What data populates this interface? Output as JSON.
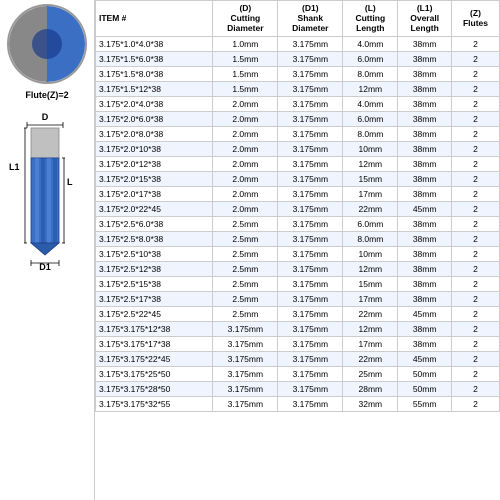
{
  "flute_label": "Flute(Z)=2",
  "labels": {
    "D": "D",
    "L": "L",
    "L1": "L1",
    "D1": "D1"
  },
  "table": {
    "headers": [
      {
        "id": "item",
        "line1": "ITEM #",
        "line2": ""
      },
      {
        "id": "D",
        "line1": "(D)",
        "line2": "Cutting Diameter"
      },
      {
        "id": "D1",
        "line1": "(D1)",
        "line2": "Shank Diameter"
      },
      {
        "id": "L",
        "line1": "(L)",
        "line2": "Cutting Length"
      },
      {
        "id": "L1",
        "line1": "(L1)",
        "line2": "Overall Length"
      },
      {
        "id": "Z",
        "line1": "(Z)",
        "line2": "Flutes"
      }
    ],
    "rows": [
      {
        "item": "3.175*1.0*4.0*38",
        "D": "1.0mm",
        "D1": "3.175mm",
        "L": "4.0mm",
        "L1": "38mm",
        "Z": "2"
      },
      {
        "item": "3.175*1.5*6.0*38",
        "D": "1.5mm",
        "D1": "3.175mm",
        "L": "6.0mm",
        "L1": "38mm",
        "Z": "2"
      },
      {
        "item": "3.175*1.5*8.0*38",
        "D": "1.5mm",
        "D1": "3.175mm",
        "L": "8.0mm",
        "L1": "38mm",
        "Z": "2"
      },
      {
        "item": "3.175*1.5*12*38",
        "D": "1.5mm",
        "D1": "3.175mm",
        "L": "12mm",
        "L1": "38mm",
        "Z": "2"
      },
      {
        "item": "3.175*2.0*4.0*38",
        "D": "2.0mm",
        "D1": "3.175mm",
        "L": "4.0mm",
        "L1": "38mm",
        "Z": "2"
      },
      {
        "item": "3.175*2.0*6.0*38",
        "D": "2.0mm",
        "D1": "3.175mm",
        "L": "6.0mm",
        "L1": "38mm",
        "Z": "2"
      },
      {
        "item": "3.175*2.0*8.0*38",
        "D": "2.0mm",
        "D1": "3.175mm",
        "L": "8.0mm",
        "L1": "38mm",
        "Z": "2"
      },
      {
        "item": "3.175*2.0*10*38",
        "D": "2.0mm",
        "D1": "3.175mm",
        "L": "10mm",
        "L1": "38mm",
        "Z": "2"
      },
      {
        "item": "3.175*2.0*12*38",
        "D": "2.0mm",
        "D1": "3.175mm",
        "L": "12mm",
        "L1": "38mm",
        "Z": "2"
      },
      {
        "item": "3.175*2.0*15*38",
        "D": "2.0mm",
        "D1": "3.175mm",
        "L": "15mm",
        "L1": "38mm",
        "Z": "2"
      },
      {
        "item": "3.175*2.0*17*38",
        "D": "2.0mm",
        "D1": "3.175mm",
        "L": "17mm",
        "L1": "38mm",
        "Z": "2"
      },
      {
        "item": "3.175*2.0*22*45",
        "D": "2.0mm",
        "D1": "3.175mm",
        "L": "22mm",
        "L1": "45mm",
        "Z": "2"
      },
      {
        "item": "3.175*2.5*6.0*38",
        "D": "2.5mm",
        "D1": "3.175mm",
        "L": "6.0mm",
        "L1": "38mm",
        "Z": "2"
      },
      {
        "item": "3.175*2.5*8.0*38",
        "D": "2.5mm",
        "D1": "3.175mm",
        "L": "8.0mm",
        "L1": "38mm",
        "Z": "2"
      },
      {
        "item": "3.175*2.5*10*38",
        "D": "2.5mm",
        "D1": "3.175mm",
        "L": "10mm",
        "L1": "38mm",
        "Z": "2"
      },
      {
        "item": "3.175*2.5*12*38",
        "D": "2.5mm",
        "D1": "3.175mm",
        "L": "12mm",
        "L1": "38mm",
        "Z": "2"
      },
      {
        "item": "3.175*2.5*15*38",
        "D": "2.5mm",
        "D1": "3.175mm",
        "L": "15mm",
        "L1": "38mm",
        "Z": "2"
      },
      {
        "item": "3.175*2.5*17*38",
        "D": "2.5mm",
        "D1": "3.175mm",
        "L": "17mm",
        "L1": "38mm",
        "Z": "2"
      },
      {
        "item": "3.175*2.5*22*45",
        "D": "2.5mm",
        "D1": "3.175mm",
        "L": "22mm",
        "L1": "45mm",
        "Z": "2"
      },
      {
        "item": "3.175*3.175*12*38",
        "D": "3.175mm",
        "D1": "3.175mm",
        "L": "12mm",
        "L1": "38mm",
        "Z": "2"
      },
      {
        "item": "3.175*3.175*17*38",
        "D": "3.175mm",
        "D1": "3.175mm",
        "L": "17mm",
        "L1": "38mm",
        "Z": "2"
      },
      {
        "item": "3.175*3.175*22*45",
        "D": "3.175mm",
        "D1": "3.175mm",
        "L": "22mm",
        "L1": "45mm",
        "Z": "2"
      },
      {
        "item": "3.175*3.175*25*50",
        "D": "3.175mm",
        "D1": "3.175mm",
        "L": "25mm",
        "L1": "50mm",
        "Z": "2"
      },
      {
        "item": "3.175*3.175*28*50",
        "D": "3.175mm",
        "D1": "3.175mm",
        "L": "28mm",
        "L1": "50mm",
        "Z": "2"
      },
      {
        "item": "3.175*3.175*32*55",
        "D": "3.175mm",
        "D1": "3.175mm",
        "L": "32mm",
        "L1": "55mm",
        "Z": "2"
      }
    ]
  }
}
